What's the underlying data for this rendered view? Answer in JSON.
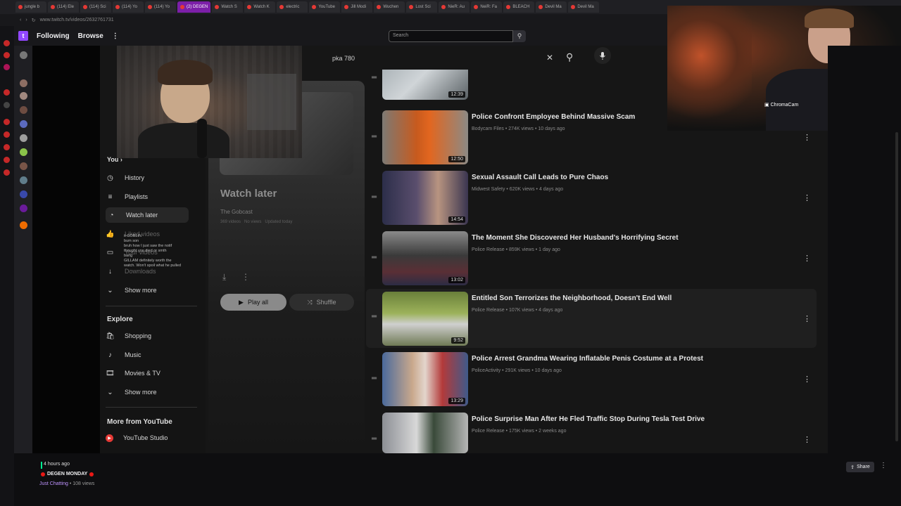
{
  "browser": {
    "tabs": [
      "jungle b",
      "(114) Ele",
      "(114) Sci",
      "(114) Yo",
      "(114) Yo",
      "(2) DEGEN",
      "Watch S",
      "Watch K",
      "electric",
      "YouTube",
      "Jill Modi",
      "Wuchen",
      "Lost Sci",
      "NieR: Au",
      "NeiR: Fa",
      "BLEACH",
      "Devil Ma",
      "Devil Ma"
    ],
    "active_tab_index": 5,
    "url": "www.twitch.tv/videos/2632761731"
  },
  "twitch_nav": {
    "logo_glyph": "t",
    "following": "Following",
    "browse": "Browse",
    "more": "⋮",
    "search_placeholder": "Search"
  },
  "yt_search": {
    "query": "pka 780",
    "clear": "✕",
    "search_icon": "⚲",
    "mic_icon": "🎤"
  },
  "yt_sidebar": {
    "you_label": "You",
    "you_arrow": "›",
    "items": [
      "History",
      "Playlists",
      "Watch later",
      "Liked videos",
      "Your videos",
      "Downloads",
      "Show more"
    ],
    "explore_label": "Explore",
    "explore_items": [
      "Shopping",
      "Music",
      "Movies & TV",
      "Show more"
    ],
    "more_from_label": "More from YouTube",
    "more_from_items": [
      "YouTube Studio"
    ]
  },
  "playlist": {
    "title": "Watch later",
    "owner": "The Gobcast",
    "count": "369 videos",
    "views": "No views",
    "updated": "Updated today",
    "play_all": "Play all",
    "shuffle": "Shuffle"
  },
  "videos": [
    {
      "title": "",
      "meta": "",
      "duration": "12:39"
    },
    {
      "title": "Police Confront Employee Behind Massive Scam",
      "meta": "Bodycam Files • 274K views • 10 days ago",
      "duration": "12:50"
    },
    {
      "title": "Sexual Assault Call Leads to Pure Chaos",
      "meta": "Midwest Safety • 620K views • 4 days ago",
      "duration": "14:54"
    },
    {
      "title": "The Moment She Discovered Her Husband's Horrifying Secret",
      "meta": "Police Release • 859K views • 1 day ago",
      "duration": "13:02"
    },
    {
      "title": "Entitled Son Terrorizes the Neighborhood, Doesn't End Well",
      "meta": "Police Release • 107K views • 4 days ago",
      "duration": "9:52"
    },
    {
      "title": "Police Arrest Grandma Wearing Inflatable Penis Costume at a Protest",
      "meta": "PoliceActivity • 291K views • 10 days ago",
      "duration": "13:29"
    },
    {
      "title": "Police Surprise Man After He Fled Traffic Stop During Tesla Test Drive",
      "meta": "Police Release • 175K views • 2 weeks ago",
      "duration": ""
    }
  ],
  "chat_overlay": [
    "it GOBLIN",
    "bum son",
    "bruh how I just saw the notif",
    "thought you died or smth",
    "bang",
    "GILLAM definitely worth the",
    "watch. Won't spoil what he pulled"
  ],
  "cam2_label": "ChromaCam",
  "stream_info": {
    "time_ago": "4 hours ago",
    "title": "DEGEN MONDAY",
    "category": "Just Chatting",
    "views": "108 views",
    "share": "Share",
    "more": "⋮"
  }
}
